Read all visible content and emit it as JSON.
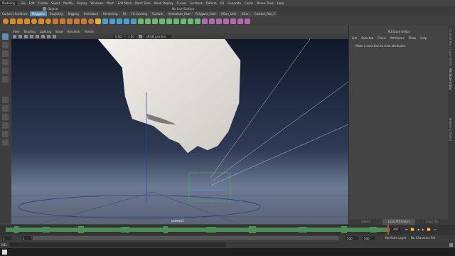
{
  "menu": [
    "Modeling",
    "File",
    "Edit",
    "Create",
    "Select",
    "Modify",
    "Display",
    "Windows",
    "Mesh",
    "Edit Mesh",
    "Mesh Tools",
    "Mesh Display",
    "Curves",
    "Surfaces",
    "Deform",
    "UV",
    "Generate",
    "Cache",
    "Bonus Tools",
    "Help"
  ],
  "status": {
    "objects_label": "Objects",
    "surface_label": "No Live Surface"
  },
  "shelf_tabs": [
    "Curves / Surfaces",
    "Polygons",
    "Sculpting",
    "Rigging",
    "Animation",
    "Rendering",
    "FX",
    "FX Caching",
    "Custom",
    "Animation_User",
    "Polygons_User",
    "XGen_User",
    "XGen",
    "Custom_Fab_1"
  ],
  "active_shelf_tab": 1,
  "panel_menu": [
    "View",
    "Shading",
    "Lighting",
    "Show",
    "Renderer",
    "Panels"
  ],
  "panel_tools": {
    "near": "0.00",
    "far": "1.00",
    "color_space": "sRGB gamma"
  },
  "viewport": {
    "camera_label": "camera1"
  },
  "attribute_editor": {
    "title": "Attribute Editor",
    "menu": [
      "List",
      "Selected",
      "Focus",
      "Attributes",
      "Show",
      "Help"
    ],
    "message": "Make a selection to view attributes",
    "buttons": [
      "Select",
      "Load Attributes",
      "Copy Tab"
    ],
    "rail_labels": [
      "Attribute Editor",
      "Channel Box / Layer Editor",
      "Modeling Toolkit"
    ]
  },
  "timeline": {
    "current_frame": "447"
  },
  "range": {
    "start": "1",
    "start2": "1",
    "end": "500",
    "end2": "500",
    "anim_layer": "No Anim Layer",
    "character": "No Character Set"
  },
  "command": {
    "label": "MEL"
  },
  "colors": {
    "accent": "#5f8fb5",
    "viewport_top": "#11182b",
    "waveform": "#4e8c5a"
  }
}
